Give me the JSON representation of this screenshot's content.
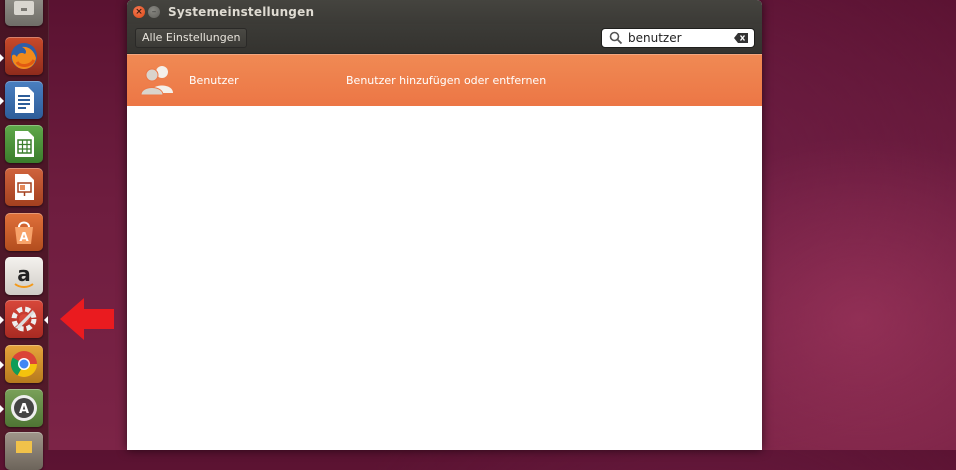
{
  "window": {
    "title": "Systemeinstellungen"
  },
  "toolbar": {
    "all_settings_label": "Alle Einstellungen"
  },
  "search": {
    "value": "benutzer",
    "icon": "search-icon",
    "clear_icon": "clear-text-icon"
  },
  "results": [
    {
      "name": "Benutzer",
      "description": "Benutzer hinzufügen oder entfernen",
      "icon": "users-icon"
    }
  ],
  "launcher": {
    "items": [
      {
        "icon": "files-icon"
      },
      {
        "icon": "firefox-icon"
      },
      {
        "icon": "libreoffice-writer-icon"
      },
      {
        "icon": "libreoffice-calc-icon"
      },
      {
        "icon": "libreoffice-impress-icon"
      },
      {
        "icon": "software-center-icon"
      },
      {
        "icon": "amazon-icon"
      },
      {
        "icon": "system-settings-icon",
        "active": true
      },
      {
        "icon": "chrome-icon"
      },
      {
        "icon": "software-updater-icon"
      },
      {
        "icon": "workspace-icon"
      }
    ]
  },
  "colors": {
    "accent": "#ec7645",
    "titlebar": "#3c3b37",
    "desktop": "#6e1d3f"
  }
}
